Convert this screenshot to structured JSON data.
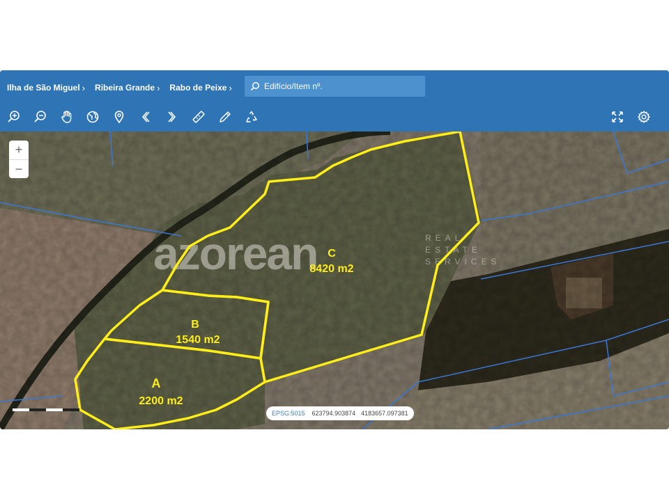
{
  "breadcrumbs": [
    "Ilha de São Miguel",
    "Ribeira Grande",
    "Rabo de Peixe"
  ],
  "search": {
    "placeholder": "Edifício/Item nº."
  },
  "toolbar": {
    "left_tools": [
      "zoom-in-icon",
      "zoom-out-icon",
      "pan-hand-icon",
      "globe-icon",
      "location-pin-icon",
      "previous-extent-icon",
      "next-extent-icon",
      "measure-ruler-icon",
      "draw-pencil-icon",
      "recycle-icon"
    ],
    "right_tools": [
      "fullscreen-icon",
      "settings-gear-icon"
    ]
  },
  "map": {
    "zoom_in": "+",
    "zoom_out": "−",
    "watermark": {
      "brand": "azorean",
      "tag": [
        "REAL",
        "ESTATE",
        "SERVICES"
      ]
    },
    "parcels": [
      {
        "letter": "A",
        "area": "2200 m2"
      },
      {
        "letter": "B",
        "area": "1540 m2"
      },
      {
        "letter": "C",
        "area": "8420 m2"
      }
    ],
    "coordinates": {
      "epsg": "EPSG:5015",
      "x": "623794.903874",
      "y": "4183657.097381"
    }
  },
  "colors": {
    "header": "#2f75b5",
    "parcel_outline": "#ffee1a",
    "cadastre_line": "#3a78d6"
  }
}
